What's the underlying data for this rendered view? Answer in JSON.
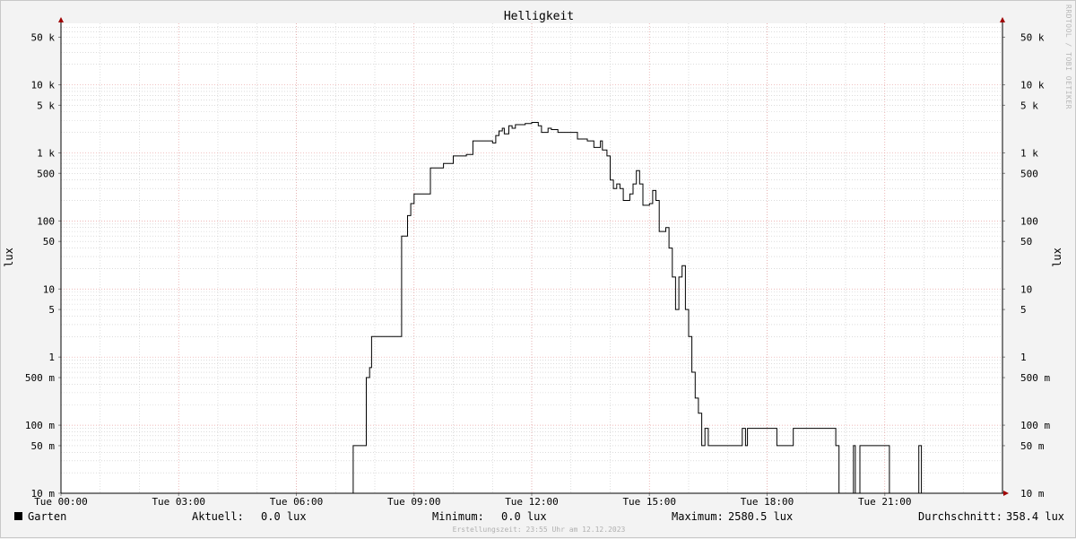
{
  "chart_data": {
    "type": "line",
    "title": "Helligkeit",
    "ylabel": "lux",
    "yscale": "log",
    "ylim": [
      0.01,
      80000
    ],
    "xlim": [
      "00:00",
      "24:00"
    ],
    "x_ticks": [
      "Tue 00:00",
      "Tue 03:00",
      "Tue 06:00",
      "Tue 09:00",
      "Tue 12:00",
      "Tue 15:00",
      "Tue 18:00",
      "Tue 21:00"
    ],
    "y_ticks": [
      {
        "value": 50000,
        "label": "50 k"
      },
      {
        "value": 10000,
        "label": "10 k"
      },
      {
        "value": 5000,
        "label": "5 k"
      },
      {
        "value": 1000,
        "label": "1 k"
      },
      {
        "value": 500,
        "label": "500"
      },
      {
        "value": 100,
        "label": "100"
      },
      {
        "value": 50,
        "label": "50"
      },
      {
        "value": 10,
        "label": "10"
      },
      {
        "value": 5,
        "label": "5"
      },
      {
        "value": 1,
        "label": "1"
      },
      {
        "value": 0.5,
        "label": "500 m"
      },
      {
        "value": 0.1,
        "label": "100 m"
      },
      {
        "value": 0.05,
        "label": "50 m"
      },
      {
        "value": 0.01,
        "label": "10 m"
      }
    ],
    "grid": true,
    "series": [
      {
        "name": "Garten",
        "color": "#000000",
        "points": [
          [
            "00:00",
            0.01
          ],
          [
            "07:25",
            0.01
          ],
          [
            "07:27",
            0.05
          ],
          [
            "07:45",
            0.05
          ],
          [
            "07:47",
            0.5
          ],
          [
            "07:52",
            0.7
          ],
          [
            "07:55",
            2
          ],
          [
            "08:39",
            2
          ],
          [
            "08:41",
            60
          ],
          [
            "08:50",
            120
          ],
          [
            "08:55",
            180
          ],
          [
            "09:00",
            250
          ],
          [
            "09:20",
            250
          ],
          [
            "09:25",
            600
          ],
          [
            "09:45",
            700
          ],
          [
            "10:00",
            900
          ],
          [
            "10:20",
            950
          ],
          [
            "10:30",
            1500
          ],
          [
            "10:45",
            1500
          ],
          [
            "11:00",
            1400
          ],
          [
            "11:05",
            1800
          ],
          [
            "11:10",
            2100
          ],
          [
            "11:15",
            2300
          ],
          [
            "11:18",
            1900
          ],
          [
            "11:25",
            2500
          ],
          [
            "11:30",
            2300
          ],
          [
            "11:35",
            2600
          ],
          [
            "11:50",
            2700
          ],
          [
            "12:00",
            2800
          ],
          [
            "12:10",
            2500
          ],
          [
            "12:15",
            2000
          ],
          [
            "12:25",
            2300
          ],
          [
            "12:30",
            2200
          ],
          [
            "12:40",
            2000
          ],
          [
            "13:00",
            2000
          ],
          [
            "13:10",
            1600
          ],
          [
            "13:25",
            1500
          ],
          [
            "13:35",
            1200
          ],
          [
            "13:45",
            1500
          ],
          [
            "13:48",
            1100
          ],
          [
            "13:55",
            900
          ],
          [
            "14:00",
            400
          ],
          [
            "14:05",
            300
          ],
          [
            "14:10",
            350
          ],
          [
            "14:15",
            300
          ],
          [
            "14:20",
            200
          ],
          [
            "14:30",
            250
          ],
          [
            "14:35",
            350
          ],
          [
            "14:40",
            550
          ],
          [
            "14:45",
            350
          ],
          [
            "14:50",
            170
          ],
          [
            "15:00",
            180
          ],
          [
            "15:05",
            280
          ],
          [
            "15:10",
            200
          ],
          [
            "15:15",
            70
          ],
          [
            "15:25",
            80
          ],
          [
            "15:30",
            40
          ],
          [
            "15:35",
            15
          ],
          [
            "15:40",
            5
          ],
          [
            "15:45",
            15
          ],
          [
            "15:50",
            22
          ],
          [
            "15:55",
            5
          ],
          [
            "16:00",
            2
          ],
          [
            "16:05",
            0.6
          ],
          [
            "16:10",
            0.25
          ],
          [
            "16:15",
            0.15
          ],
          [
            "16:20",
            0.05
          ],
          [
            "16:25",
            0.09
          ],
          [
            "16:30",
            0.05
          ],
          [
            "17:20",
            0.05
          ],
          [
            "17:22",
            0.09
          ],
          [
            "17:27",
            0.05
          ],
          [
            "17:30",
            0.09
          ],
          [
            "18:10",
            0.09
          ],
          [
            "18:15",
            0.05
          ],
          [
            "18:35",
            0.05
          ],
          [
            "18:40",
            0.09
          ],
          [
            "19:35",
            0.09
          ],
          [
            "19:45",
            0.05
          ],
          [
            "19:50",
            0.01
          ],
          [
            "20:10",
            0.01
          ],
          [
            "20:12",
            0.05
          ],
          [
            "20:15",
            0.01
          ],
          [
            "20:20",
            0.01
          ],
          [
            "20:22",
            0.05
          ],
          [
            "21:05",
            0.05
          ],
          [
            "21:07",
            0.01
          ],
          [
            "21:50",
            0.01
          ],
          [
            "21:52",
            0.05
          ],
          [
            "21:56",
            0.01
          ],
          [
            "24:00",
            0.01
          ]
        ]
      }
    ]
  },
  "watermark": "RRDTOOL / TOBI OETIKER",
  "legend": {
    "name": "Garten",
    "current_label": "Aktuell:",
    "current": "0.0 lux",
    "min_label": "Minimum:",
    "min": "0.0 lux",
    "max_label": "Maximum:",
    "max": "2580.5 lux",
    "avg_label": "Durchschnitt:",
    "avg": "358.4 lux"
  },
  "footer": "Erstellungszeit: 23:55 Uhr am 12.12.2023",
  "colors": {
    "background": "#f3f3f3",
    "canvas": "#ffffff",
    "major_grid": "#e8a0a0",
    "minor_grid": "#c8c8c8",
    "axis": "#000000",
    "arrow": "#a00000"
  }
}
